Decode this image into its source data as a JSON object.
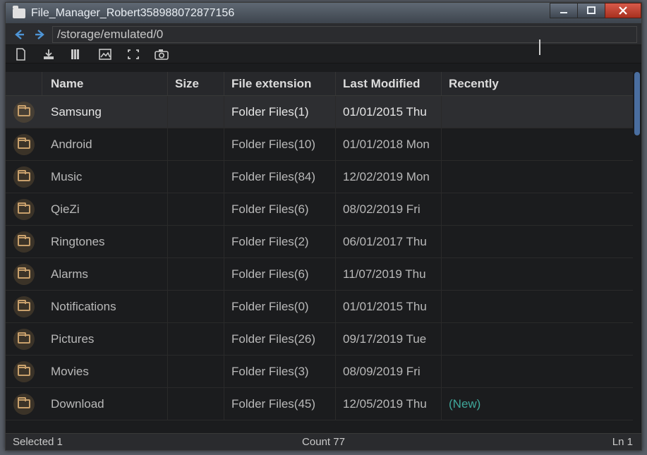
{
  "window": {
    "title": "File_Manager_Robert358988072877156"
  },
  "navigation": {
    "path": "/storage/emulated/0"
  },
  "columns": {
    "name": "Name",
    "size": "Size",
    "ext": "File extension",
    "modified": "Last Modified",
    "recently": "Recently"
  },
  "rows": [
    {
      "name": "Samsung",
      "size": "",
      "ext": "Folder Files(1)",
      "modified": "01/01/2015 Thu",
      "recently": "",
      "selected": true
    },
    {
      "name": "Android",
      "size": "",
      "ext": "Folder Files(10)",
      "modified": "01/01/2018 Mon",
      "recently": ""
    },
    {
      "name": "Music",
      "size": "",
      "ext": "Folder Files(84)",
      "modified": "12/02/2019 Mon",
      "recently": ""
    },
    {
      "name": "QieZi",
      "size": "",
      "ext": "Folder Files(6)",
      "modified": "08/02/2019 Fri",
      "recently": ""
    },
    {
      "name": "Ringtones",
      "size": "",
      "ext": "Folder Files(2)",
      "modified": "06/01/2017 Thu",
      "recently": ""
    },
    {
      "name": "Alarms",
      "size": "",
      "ext": "Folder Files(6)",
      "modified": "11/07/2019 Thu",
      "recently": ""
    },
    {
      "name": "Notifications",
      "size": "",
      "ext": "Folder Files(0)",
      "modified": "01/01/2015 Thu",
      "recently": ""
    },
    {
      "name": "Pictures",
      "size": "",
      "ext": "Folder Files(26)",
      "modified": "09/17/2019 Tue",
      "recently": ""
    },
    {
      "name": "Movies",
      "size": "",
      "ext": "Folder Files(3)",
      "modified": "08/09/2019 Fri",
      "recently": ""
    },
    {
      "name": "Download",
      "size": "",
      "ext": "Folder Files(45)",
      "modified": "12/05/2019 Thu",
      "recently": "(New)"
    }
  ],
  "statusbar": {
    "selected": "Selected 1",
    "count": "Count 77",
    "line": "Ln 1"
  }
}
